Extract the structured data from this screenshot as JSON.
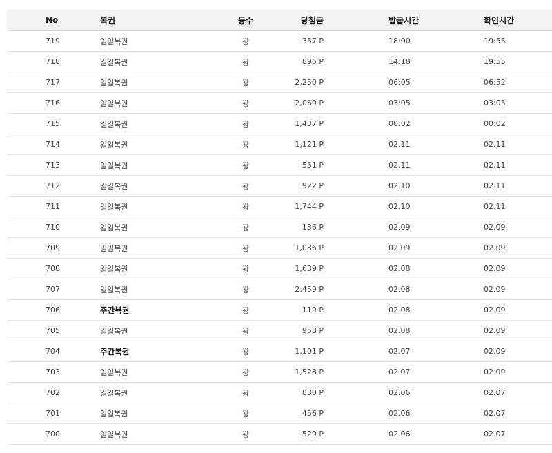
{
  "table": {
    "headers": {
      "no": "No",
      "name": "복권",
      "rank": "등수",
      "amount": "당첨금",
      "issued": "발급시간",
      "checked": "확인시간"
    },
    "rows": [
      {
        "no": "719",
        "name": "일일복권",
        "rank": "꽝",
        "amount": "357 P",
        "issued": "18:00",
        "checked": "19:55",
        "bold": false
      },
      {
        "no": "718",
        "name": "일일복권",
        "rank": "꽝",
        "amount": "896 P",
        "issued": "14:18",
        "checked": "19:55",
        "bold": false
      },
      {
        "no": "717",
        "name": "일일복권",
        "rank": "꽝",
        "amount": "2,250 P",
        "issued": "06:05",
        "checked": "06:52",
        "bold": false
      },
      {
        "no": "716",
        "name": "일일복권",
        "rank": "꽝",
        "amount": "2,069 P",
        "issued": "03:05",
        "checked": "03:05",
        "bold": false
      },
      {
        "no": "715",
        "name": "일일복권",
        "rank": "꽝",
        "amount": "1,437 P",
        "issued": "00:02",
        "checked": "00:02",
        "bold": false
      },
      {
        "no": "714",
        "name": "일일복권",
        "rank": "꽝",
        "amount": "1,121 P",
        "issued": "02.11",
        "checked": "02.11",
        "bold": false
      },
      {
        "no": "713",
        "name": "일일복권",
        "rank": "꽝",
        "amount": "551 P",
        "issued": "02.11",
        "checked": "02.11",
        "bold": false
      },
      {
        "no": "712",
        "name": "일일복권",
        "rank": "꽝",
        "amount": "922 P",
        "issued": "02.10",
        "checked": "02.11",
        "bold": false
      },
      {
        "no": "711",
        "name": "일일복권",
        "rank": "꽝",
        "amount": "1,744 P",
        "issued": "02.10",
        "checked": "02.11",
        "bold": false
      },
      {
        "no": "710",
        "name": "일일복권",
        "rank": "꽝",
        "amount": "136 P",
        "issued": "02.09",
        "checked": "02.09",
        "bold": false
      },
      {
        "no": "709",
        "name": "일일복권",
        "rank": "꽝",
        "amount": "1,036 P",
        "issued": "02.09",
        "checked": "02.09",
        "bold": false
      },
      {
        "no": "708",
        "name": "일일복권",
        "rank": "꽝",
        "amount": "1,639 P",
        "issued": "02.08",
        "checked": "02.09",
        "bold": false
      },
      {
        "no": "707",
        "name": "일일복권",
        "rank": "꽝",
        "amount": "2,459 P",
        "issued": "02.08",
        "checked": "02.09",
        "bold": false
      },
      {
        "no": "706",
        "name": "주간복권",
        "rank": "꽝",
        "amount": "119 P",
        "issued": "02.08",
        "checked": "02.09",
        "bold": true
      },
      {
        "no": "705",
        "name": "일일복권",
        "rank": "꽝",
        "amount": "958 P",
        "issued": "02.08",
        "checked": "02.09",
        "bold": false
      },
      {
        "no": "704",
        "name": "주간복권",
        "rank": "꽝",
        "amount": "1,101 P",
        "issued": "02.07",
        "checked": "02.09",
        "bold": true
      },
      {
        "no": "703",
        "name": "일일복권",
        "rank": "꽝",
        "amount": "1,528 P",
        "issued": "02.07",
        "checked": "02.09",
        "bold": false
      },
      {
        "no": "702",
        "name": "일일복권",
        "rank": "꽝",
        "amount": "830 P",
        "issued": "02.06",
        "checked": "02.07",
        "bold": false
      },
      {
        "no": "701",
        "name": "일일복권",
        "rank": "꽝",
        "amount": "456 P",
        "issued": "02.06",
        "checked": "02.07",
        "bold": false
      },
      {
        "no": "700",
        "name": "일일복권",
        "rank": "꽝",
        "amount": "529 P",
        "issued": "02.06",
        "checked": "02.07",
        "bold": false
      }
    ]
  }
}
